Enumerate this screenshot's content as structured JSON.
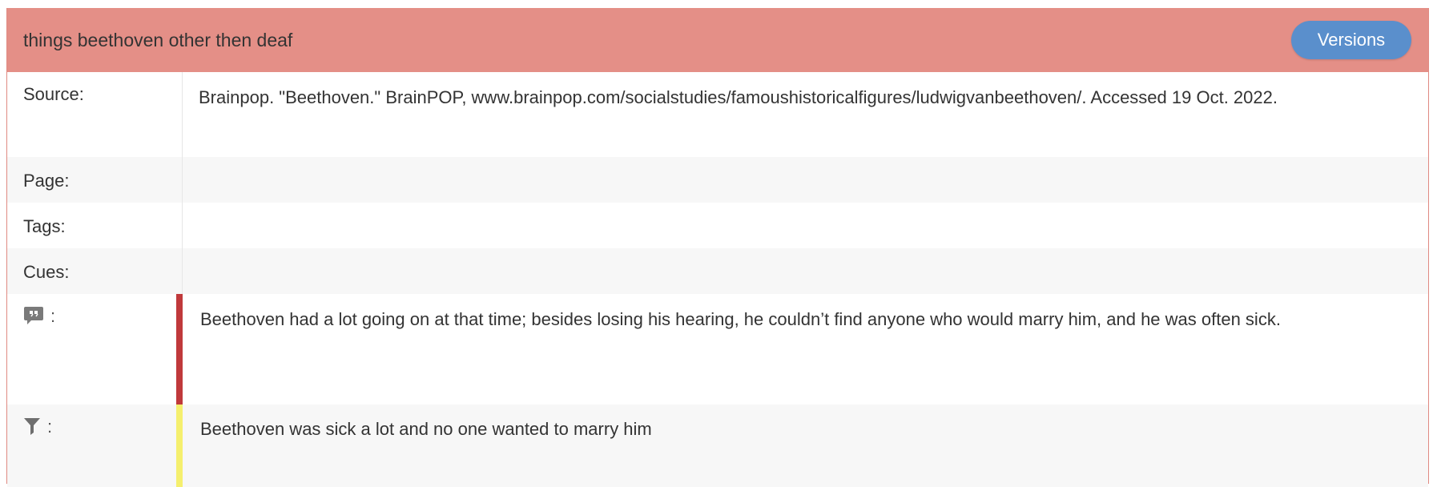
{
  "header": {
    "title": "things beethoven other then deaf",
    "versions_label": "Versions"
  },
  "fields": {
    "source_label": "Source:",
    "source_value": "Brainpop. \"Beethoven.\" BrainPOP, www.brainpop.com/socialstudies/famoushistoricalfigures/ludwigvanbeethoven/. Accessed 19 Oct. 2022.",
    "page_label": "Page:",
    "page_value": "",
    "tags_label": "Tags:",
    "tags_value": "",
    "cues_label": "Cues:",
    "cues_value": ""
  },
  "note": {
    "icon": "quote-bubble-icon",
    "colon": ":",
    "text": "Beethoven had a lot going on at that time; besides losing his hearing, he couldn’t find anyone who would marry him, and he was often sick.",
    "bar_color": "#c0393b"
  },
  "summary": {
    "icon": "filter-funnel-icon",
    "colon": ":",
    "text": "Beethoven was sick a lot and no one wanted to marry him",
    "bar_color": "#f5ef6e"
  },
  "colors": {
    "header_bg": "#e48f87",
    "versions_bg": "#5a8fcc"
  }
}
